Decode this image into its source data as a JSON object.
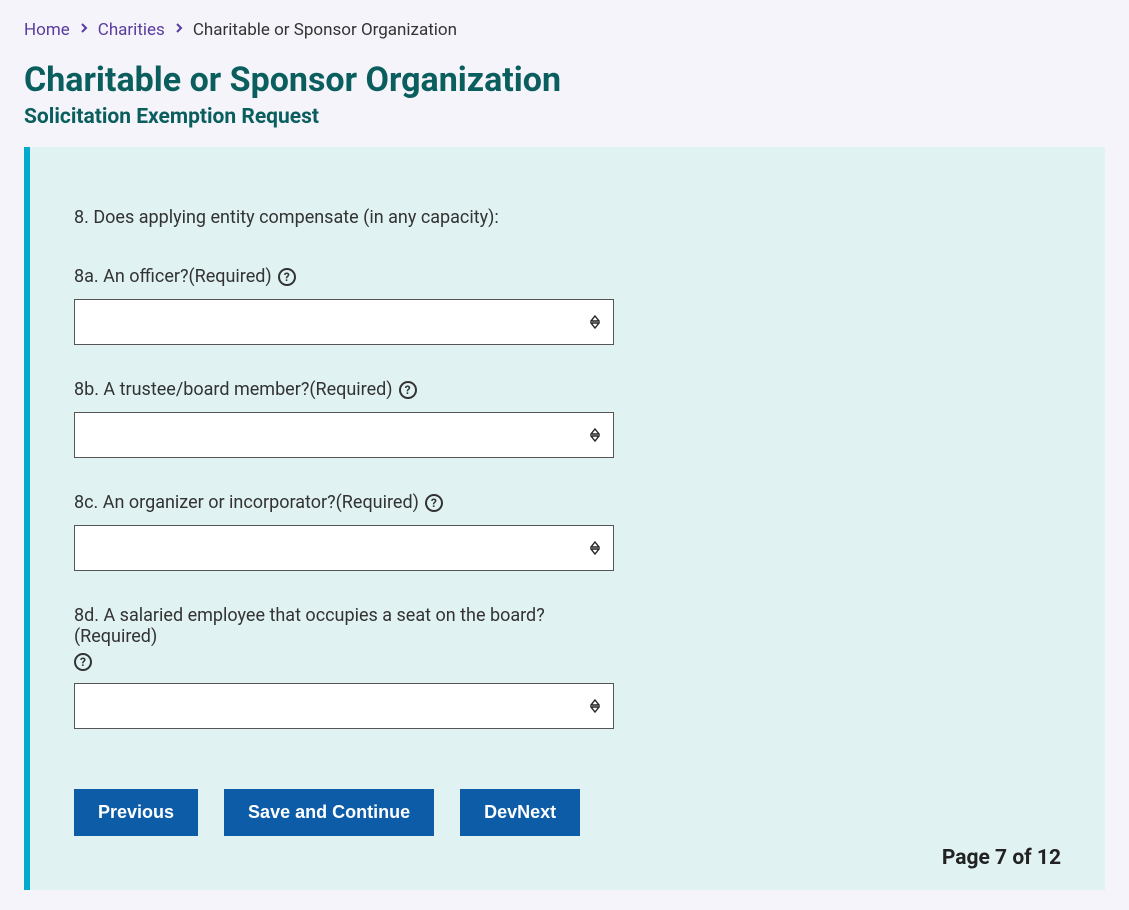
{
  "breadcrumb": {
    "home": "Home",
    "charities": "Charities",
    "current": "Charitable or Sponsor Organization"
  },
  "page_title": "Charitable or Sponsor Organization",
  "subtitle": "Solicitation Exemption Request",
  "question_intro": "8. Does applying entity compensate (in any capacity):",
  "fields": {
    "q8a": {
      "label": "8a. An officer?(Required)"
    },
    "q8b": {
      "label": "8b. A trustee/board member?(Required)"
    },
    "q8c": {
      "label": "8c. An organizer or incorporator?(Required)"
    },
    "q8d": {
      "label": "8d. A salaried employee that occupies a seat on the board?(Required)"
    }
  },
  "buttons": {
    "previous": "Previous",
    "save_continue": "Save and Continue",
    "devnext": "DevNext"
  },
  "page_indicator": "Page 7 of 12"
}
